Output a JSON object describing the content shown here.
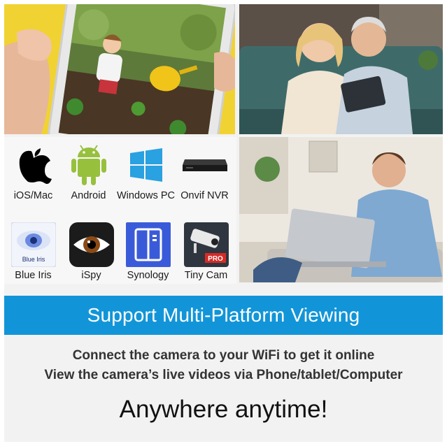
{
  "platforms": [
    {
      "label": "iOS/Mac",
      "icon": "apple-icon"
    },
    {
      "label": "Android",
      "icon": "android-icon"
    },
    {
      "label": "Windows PC",
      "icon": "windows-icon"
    },
    {
      "label": "Onvif NVR",
      "icon": "nvr-device-icon"
    },
    {
      "label": "Blue Iris",
      "icon": "blue-iris-icon",
      "logo_text": "Blue Iris"
    },
    {
      "label": "iSpy",
      "icon": "ispy-eye-icon"
    },
    {
      "label": "Synology",
      "icon": "synology-icon"
    },
    {
      "label": "Tiny Cam",
      "icon": "tinycam-icon",
      "badge": "PRO"
    }
  ],
  "banner": {
    "text": "Support Multi-Platform Viewing",
    "color": "#1295d8"
  },
  "descriptions": [
    "Connect the camera to your WiFi to get it online",
    "View the camera’s live videos via Phone/tablet/Computer"
  ],
  "tagline": "Anywhere anytime!",
  "photos": [
    {
      "subject": "hand-holding-phone-showing-child-gardening"
    },
    {
      "subject": "couple-on-sofa-with-tablet"
    },
    {
      "subject": "man-on-sofa-with-laptop"
    }
  ]
}
